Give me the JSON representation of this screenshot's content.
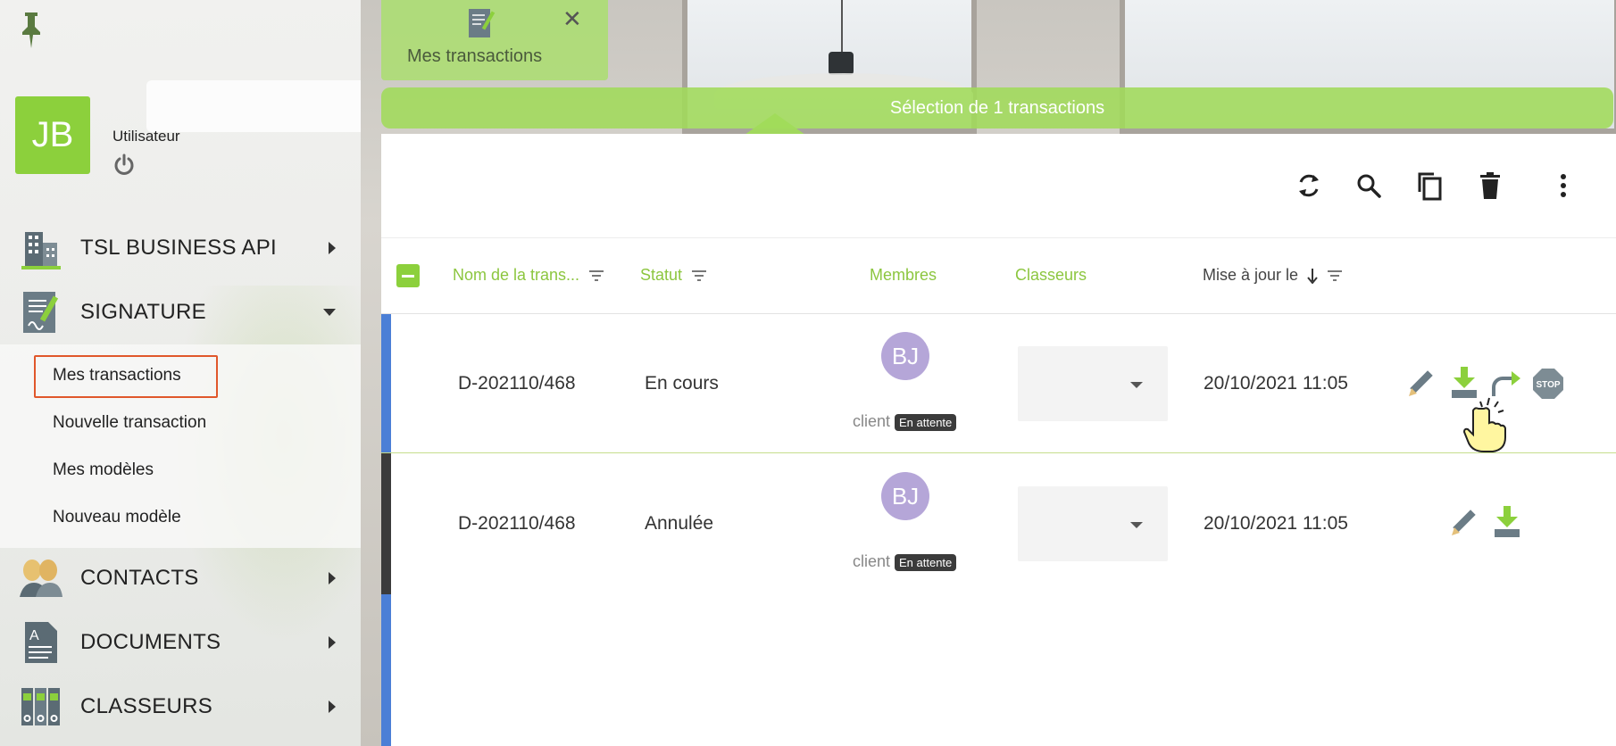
{
  "sidebar": {
    "user": {
      "initials": "JB",
      "role": "Utilisateur"
    },
    "nav": [
      {
        "label": "TSL BUSINESS API",
        "icon": "building-icon"
      },
      {
        "label": "SIGNATURE",
        "icon": "signature-document-icon"
      },
      {
        "label": "CONTACTS",
        "icon": "contacts-icon"
      },
      {
        "label": "DOCUMENTS",
        "icon": "document-icon"
      },
      {
        "label": "CLASSEURS",
        "icon": "binders-icon"
      }
    ],
    "signature_sub": [
      {
        "label": "Mes transactions"
      },
      {
        "label": "Nouvelle transaction"
      },
      {
        "label": "Mes modèles"
      },
      {
        "label": "Nouveau modèle"
      }
    ]
  },
  "tab": {
    "label": "Mes transactions",
    "close": "✕"
  },
  "selection_bar": {
    "text": "Sélection de 1 transactions"
  },
  "table": {
    "columns": {
      "name": "Nom de la trans...",
      "status": "Statut",
      "members": "Membres",
      "binders": "Classeurs",
      "updated": "Mise à jour le"
    },
    "rows": [
      {
        "name": "D-202110/468",
        "status": "En cours",
        "member_initials": "BJ",
        "member_role": "client",
        "member_badge": "En attente",
        "updated": "20/10/2021 11:05",
        "bar_color": "#4b7fd6"
      },
      {
        "name": "D-202110/468",
        "status": "Annulée",
        "member_initials": "BJ",
        "member_role": "client",
        "member_badge": "En attente",
        "updated": "20/10/2021 11:05",
        "bar_color": "#3b3b3b"
      }
    ]
  },
  "colors": {
    "accent": "#8cd03c",
    "avatar_member": "#b5a6d8",
    "highlight_frame": "#e0572b"
  },
  "stop_label": "STOP"
}
